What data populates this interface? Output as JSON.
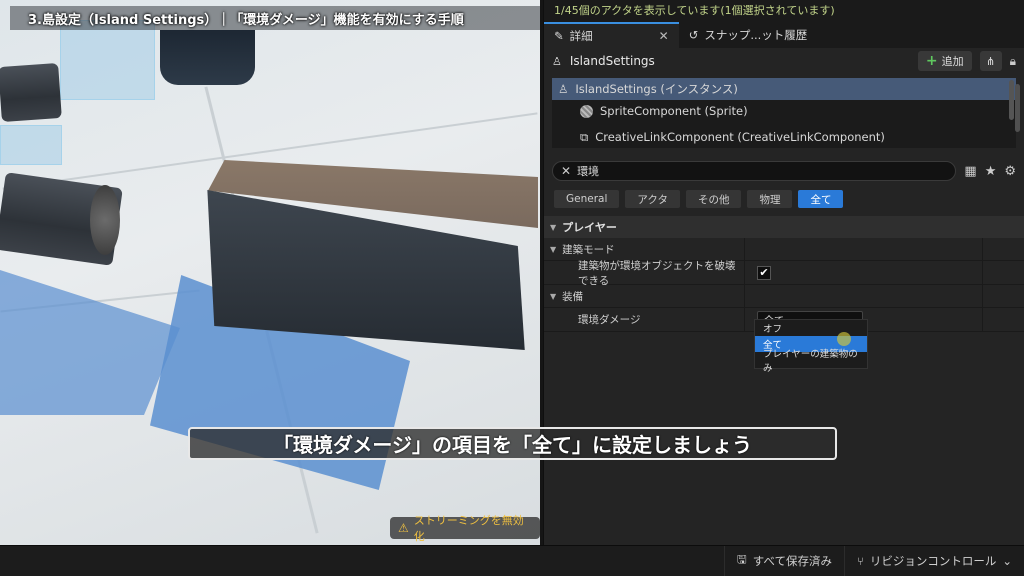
{
  "viewport": {
    "title_banner": "3.島設定（Island Settings）｜「環境ダメージ」機能を有効にする手順",
    "streaming_button": "ストリーミングを無効化"
  },
  "panel": {
    "status": "1/45個のアクタを表示しています(1個選択されています)",
    "tabs": [
      {
        "label": "詳細"
      },
      {
        "label": "スナップ...ット履歴"
      }
    ],
    "actor_name": "IslandSettings",
    "add_button": "追加",
    "components": [
      "IslandSettings (インスタンス)",
      "SpriteComponent (Sprite)",
      "CreativeLinkComponent (CreativeLinkComponent)"
    ],
    "search": {
      "value": "環境"
    },
    "filters": [
      "General",
      "アクタ",
      "その他",
      "物理",
      "全て"
    ],
    "active_filter": "全て",
    "categories": {
      "player": "プレイヤー",
      "build_mode": "建築モード",
      "equipment": "装備"
    },
    "properties": {
      "destroy_env_label": "建築物が環境オブジェクトを破壊できる",
      "destroy_env_checked": true,
      "env_damage_label": "環境ダメージ",
      "env_damage_value": "全て"
    },
    "dropdown_options": [
      "オフ",
      "全て",
      "プレイヤーの建築物のみ"
    ],
    "dropdown_selected": "全て"
  },
  "subtitle": "「環境ダメージ」の項目を「全て」に設定しましょう",
  "bottom_bar": {
    "save_all": "すべて保存済み",
    "revision_control": "リビジョンコントロール"
  },
  "colors": {
    "accent": "#2a7ad8",
    "status_text": "#c2d48a",
    "warning": "#f0c040",
    "selected_component": "#465a78"
  }
}
